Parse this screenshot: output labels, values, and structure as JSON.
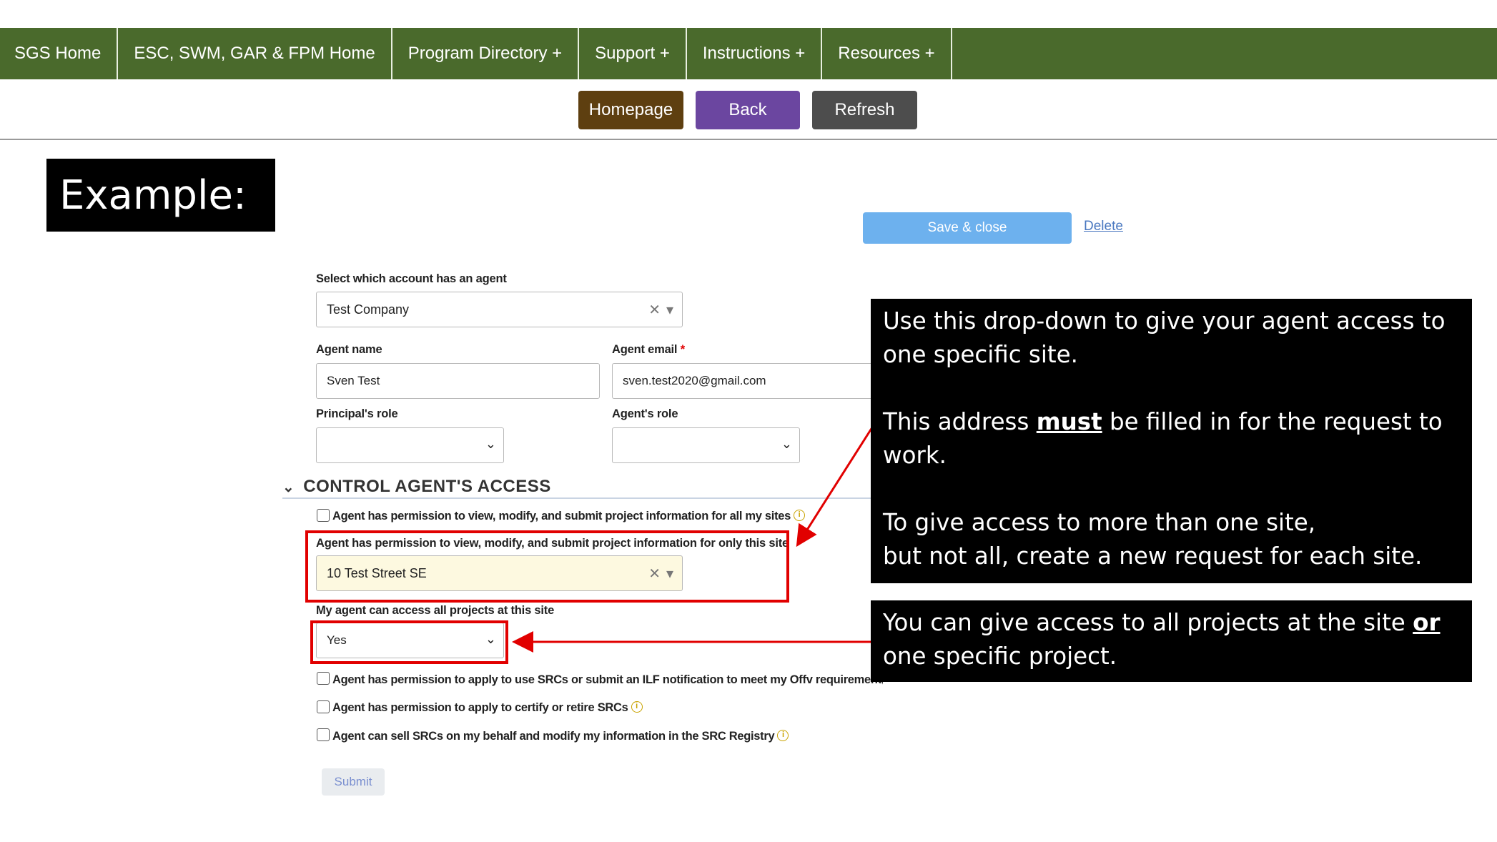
{
  "nav": {
    "items": [
      "SGS Home",
      "ESC, SWM, GAR & FPM Home",
      "Program Directory +",
      "Support +",
      "Instructions +",
      "Resources +"
    ]
  },
  "buttons": {
    "homepage": "Homepage",
    "back": "Back",
    "refresh": "Refresh"
  },
  "example_label": "Example:",
  "actions": {
    "save_close": "Save & close",
    "delete": "Delete"
  },
  "form": {
    "account_label": "Select which account has an agent",
    "account_value": "Test Company",
    "agent_name_label": "Agent name",
    "agent_name_value": "Sven Test",
    "agent_email_label": "Agent email",
    "agent_email_required": "*",
    "agent_email_value": "sven.test2020@gmail.com",
    "principal_role_label": "Principal's role",
    "agent_role_label": "Agent's role",
    "section_title": "CONTROL AGENT'S ACCESS",
    "perm_all_sites": "Agent has permission to view, modify, and submit project information for all my sites",
    "perm_only_site": "Agent has permission to view, modify, and submit project information for only this site",
    "site_value": "10 Test Street SE",
    "all_projects_label": "My agent can access all projects at this site",
    "all_projects_value": "Yes",
    "perm_srcs_ilf": "Agent has permission to apply to use SRCs or submit an ILF notification to meet my Offv requirement(s)",
    "perm_certify": "Agent has permission to apply to certify or retire SRCs",
    "perm_sell": "Agent can sell SRCs on my behalf and modify my information in the SRC Registry",
    "submit": "Submit",
    "info_glyph": "i"
  },
  "callout1": {
    "line1": "Use this drop-down to give your agent access to",
    "line2": "one specific site.",
    "line3_pre": "This address ",
    "line3_bold": "must",
    "line3_post": " be filled in for the request to",
    "line4": "work.",
    "line5": "To give access to more than one site,",
    "line6": "but not all, create a new request for each site."
  },
  "callout2": {
    "line1_pre": "You can give access to all projects at the site ",
    "line1_bold": "or",
    "line2": "one specific project."
  },
  "colors": {
    "nav_bg": "#4a6a2c",
    "homepage_btn": "#5e3f10",
    "back_btn": "#6b46a0",
    "refresh_btn": "#4d4d4d",
    "save_btn": "#6db1ee",
    "highlight_red": "#e10000"
  }
}
